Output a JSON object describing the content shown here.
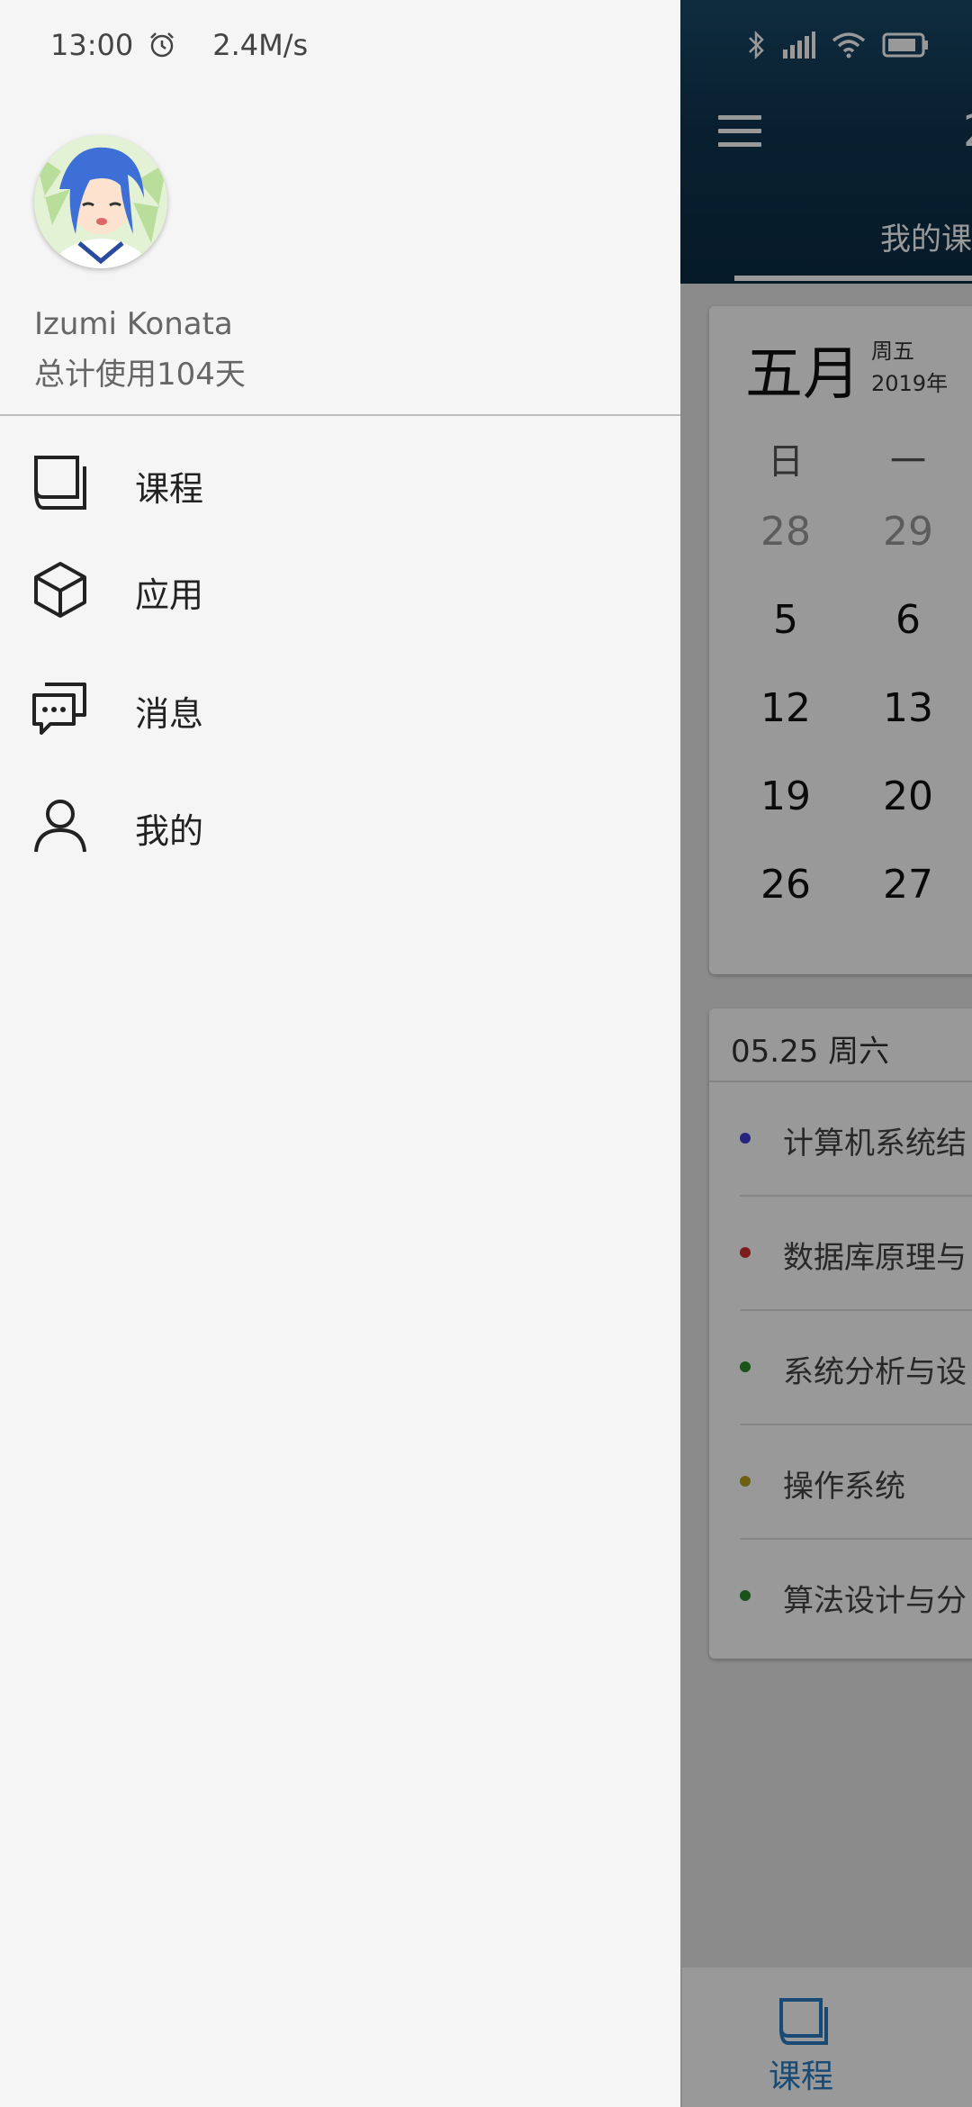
{
  "status_bar": {
    "time": "13:00",
    "net_speed": "2.4M/s",
    "icons": [
      "alarm-icon",
      "bluetooth-icon",
      "signal-icon",
      "wifi-icon",
      "battery-icon"
    ]
  },
  "drawer": {
    "user_name": "Izumi Konata",
    "usage_text": "总计使用104天",
    "menu": [
      {
        "label": "课程",
        "icon": "book-icon"
      },
      {
        "label": "应用",
        "icon": "cube-icon"
      },
      {
        "label": "消息",
        "icon": "chat-icon"
      },
      {
        "label": "我的",
        "icon": "person-icon"
      }
    ]
  },
  "app": {
    "header": {
      "title_partial": "2",
      "tab_label": "我的课"
    },
    "calendar": {
      "month": "五月",
      "weekday": "周五",
      "year": "2019年",
      "day_headers": [
        "日",
        "一"
      ],
      "rows": [
        [
          "28",
          "29"
        ],
        [
          "5",
          "6"
        ],
        [
          "12",
          "13"
        ],
        [
          "19",
          "20"
        ],
        [
          "26",
          "27"
        ]
      ]
    },
    "schedule": {
      "date_header": "05.25 周六",
      "courses": [
        {
          "name": "计算机系统结",
          "color": "#3f3fd0"
        },
        {
          "name": "数据库原理与",
          "color": "#d03030"
        },
        {
          "name": "系统分析与设",
          "color": "#2a8a2a"
        },
        {
          "name": "操作系统",
          "color": "#b8a020"
        },
        {
          "name": "算法设计与分",
          "color": "#2a8a2a"
        }
      ]
    },
    "bottom_nav": {
      "label": "课程",
      "color": "#2a7cc0"
    }
  }
}
